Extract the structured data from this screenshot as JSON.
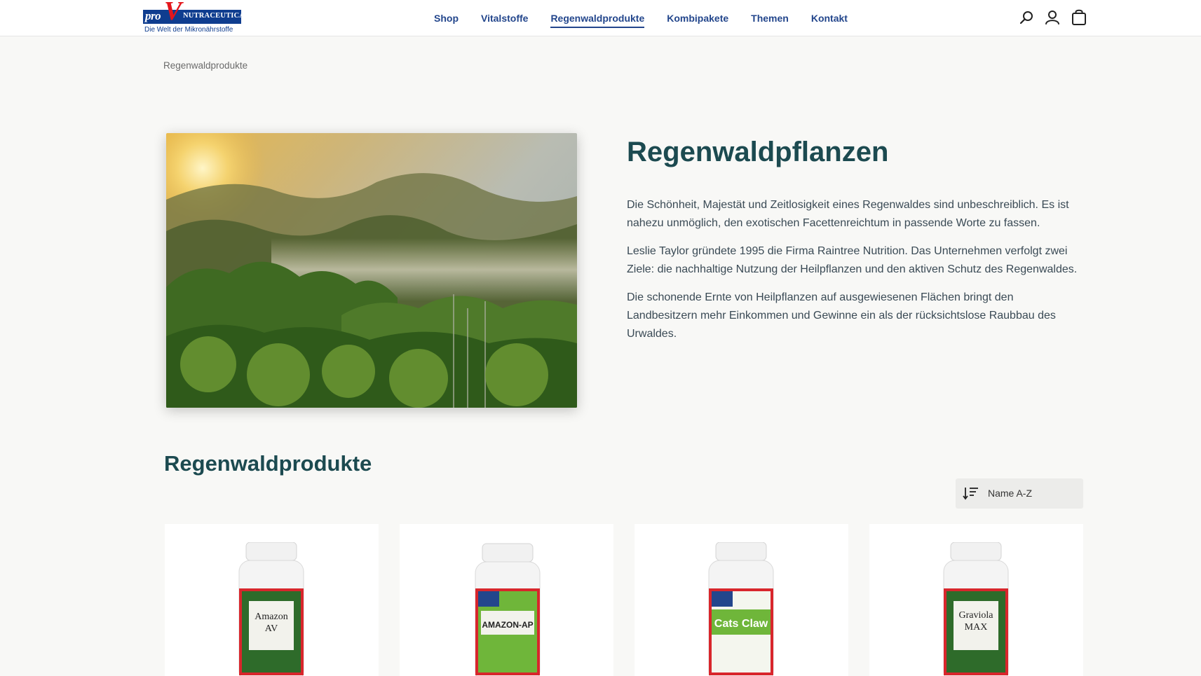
{
  "logo": {
    "pro": "pro",
    "v": "V",
    "nutraceutical": "NUTRACEUTICAL",
    "tagline": "Die Welt der Mikronährstoffe"
  },
  "nav": {
    "items": [
      {
        "label": "Shop"
      },
      {
        "label": "Vitalstoffe"
      },
      {
        "label": "Regenwaldprodukte",
        "active": true
      },
      {
        "label": "Kombipakete"
      },
      {
        "label": "Themen"
      },
      {
        "label": "Kontakt"
      }
    ]
  },
  "header_icons": [
    "search-icon",
    "user-icon",
    "cart-icon"
  ],
  "breadcrumb": "Regenwaldprodukte",
  "hero": {
    "title": "Regenwaldpflanzen",
    "paragraphs": [
      "Die Schönheit, Majestät und Zeitlosigkeit eines Regenwaldes sind unbeschreiblich. Es ist nahezu unmöglich, den exotischen Facettenreichtum in passende Worte zu fassen.",
      "Leslie Taylor gründete 1995 die Firma Raintree Nutrition. Das Unternehmen verfolgt zwei Ziele: die nachhaltige Nutzung der Heilpflanzen und den aktiven Schutz des Regenwaldes.",
      "Die schonende Ernte von Heilpflanzen auf ausgewiesenen Flächen bringt den Landbesitzern mehr Einkommen und Gewinne ein als der rücksichtslose Raubbau des Urwaldes."
    ]
  },
  "products": {
    "title": "Regenwaldprodukte",
    "sort_label": "Name A-Z",
    "items": [
      {
        "label_line1": "Amazon",
        "label_line2": "AV"
      },
      {
        "label_line1": "AMAZON-AP",
        "label_line2": ""
      },
      {
        "label_line1": "Cats Claw",
        "label_line2": ""
      },
      {
        "label_line1": "Graviola",
        "label_line2": "MAX"
      }
    ]
  },
  "colors": {
    "brand_blue": "#23468c",
    "heading_teal": "#1c4a50",
    "logo_red": "#e3161c",
    "background": "#f8f8f6"
  }
}
